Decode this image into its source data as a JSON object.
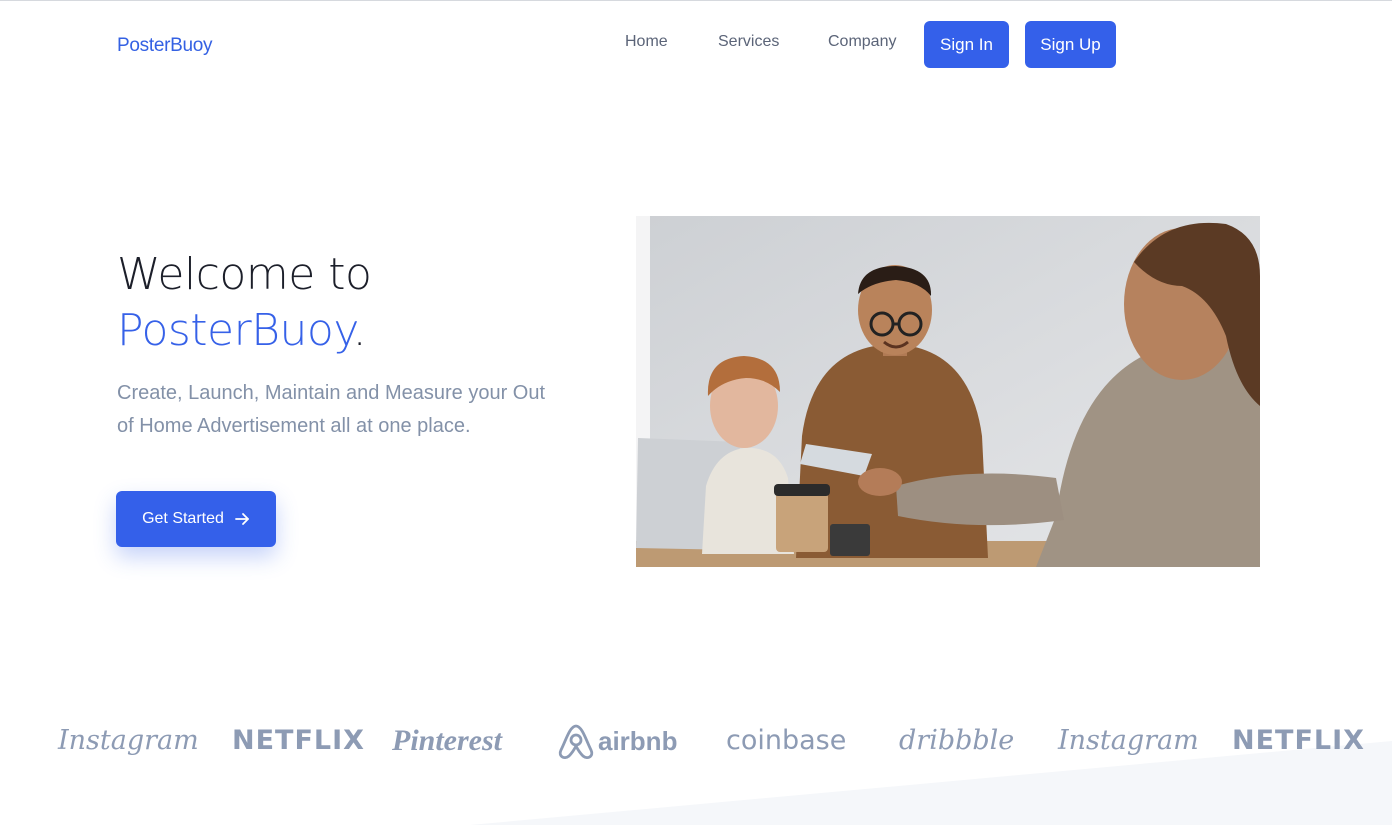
{
  "nav": {
    "brand": "PosterBuoy",
    "links": [
      "Home",
      "Services",
      "Company"
    ],
    "sign_in": "Sign In",
    "sign_up": "Sign Up"
  },
  "hero": {
    "title_prefix": "Welcome to",
    "title_brand": "PosterBuoy",
    "title_suffix": ".",
    "subtitle": "Create, Launch, Maintain and Measure your Out of Home Advertisement all at one place.",
    "cta_label": "Get Started",
    "cta_icon": "arrow-right-icon"
  },
  "logos": [
    "Instagram",
    "NETFLIX",
    "Pinterest",
    "airbnb",
    "coinbase",
    "dribbble",
    "Instagram",
    "NETFLIX"
  ],
  "colors": {
    "accent": "#3460ea",
    "brand_text": "#3461e3",
    "muted_text": "#8391a8",
    "logo_gray": "#8d9bb4"
  }
}
